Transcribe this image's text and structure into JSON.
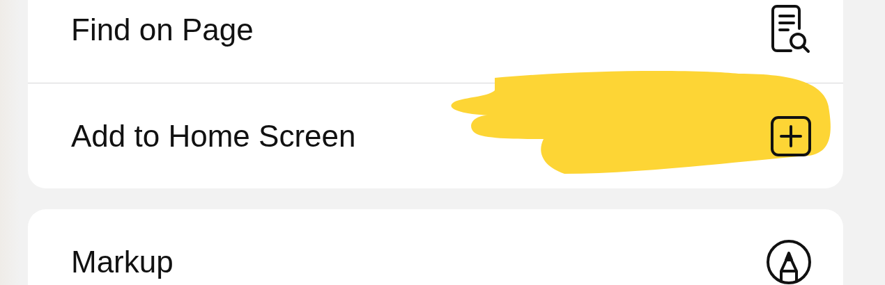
{
  "groups": [
    {
      "items": [
        {
          "label": "Find on Page"
        },
        {
          "label": "Add to Home Screen"
        }
      ]
    },
    {
      "items": [
        {
          "label": "Markup"
        }
      ]
    }
  ]
}
